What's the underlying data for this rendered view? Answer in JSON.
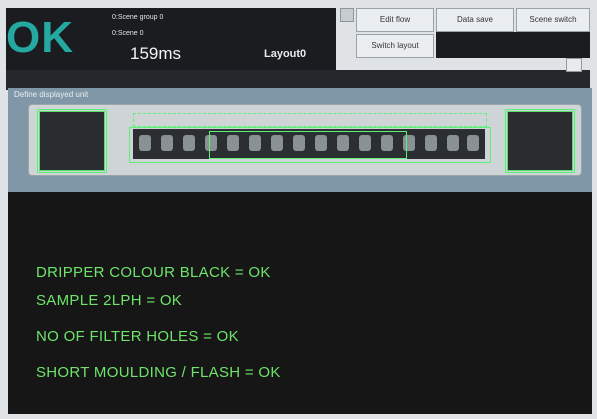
{
  "status": {
    "result": "OK",
    "scene_group": "0:Scene group 0",
    "scene": "0:Scene 0",
    "time": "159ms",
    "layout": "Layout0"
  },
  "toolbar": {
    "edit_flow": "Edit flow",
    "data_save": "Data save",
    "scene_switch": "Scene switch",
    "switch_layout": "Switch layout"
  },
  "image_panel": {
    "label": "Define displayed unit"
  },
  "results": {
    "lines": [
      "DRIPPER COLOUR BLACK = OK",
      "SAMPLE 2LPH = OK",
      "NO OF FILTER HOLES = OK",
      "SHORT MOULDING / FLASH = OK"
    ],
    "text_color": "#6fe46b"
  },
  "colors": {
    "ok": "#25a8a2",
    "detection": "#5ff07a"
  }
}
